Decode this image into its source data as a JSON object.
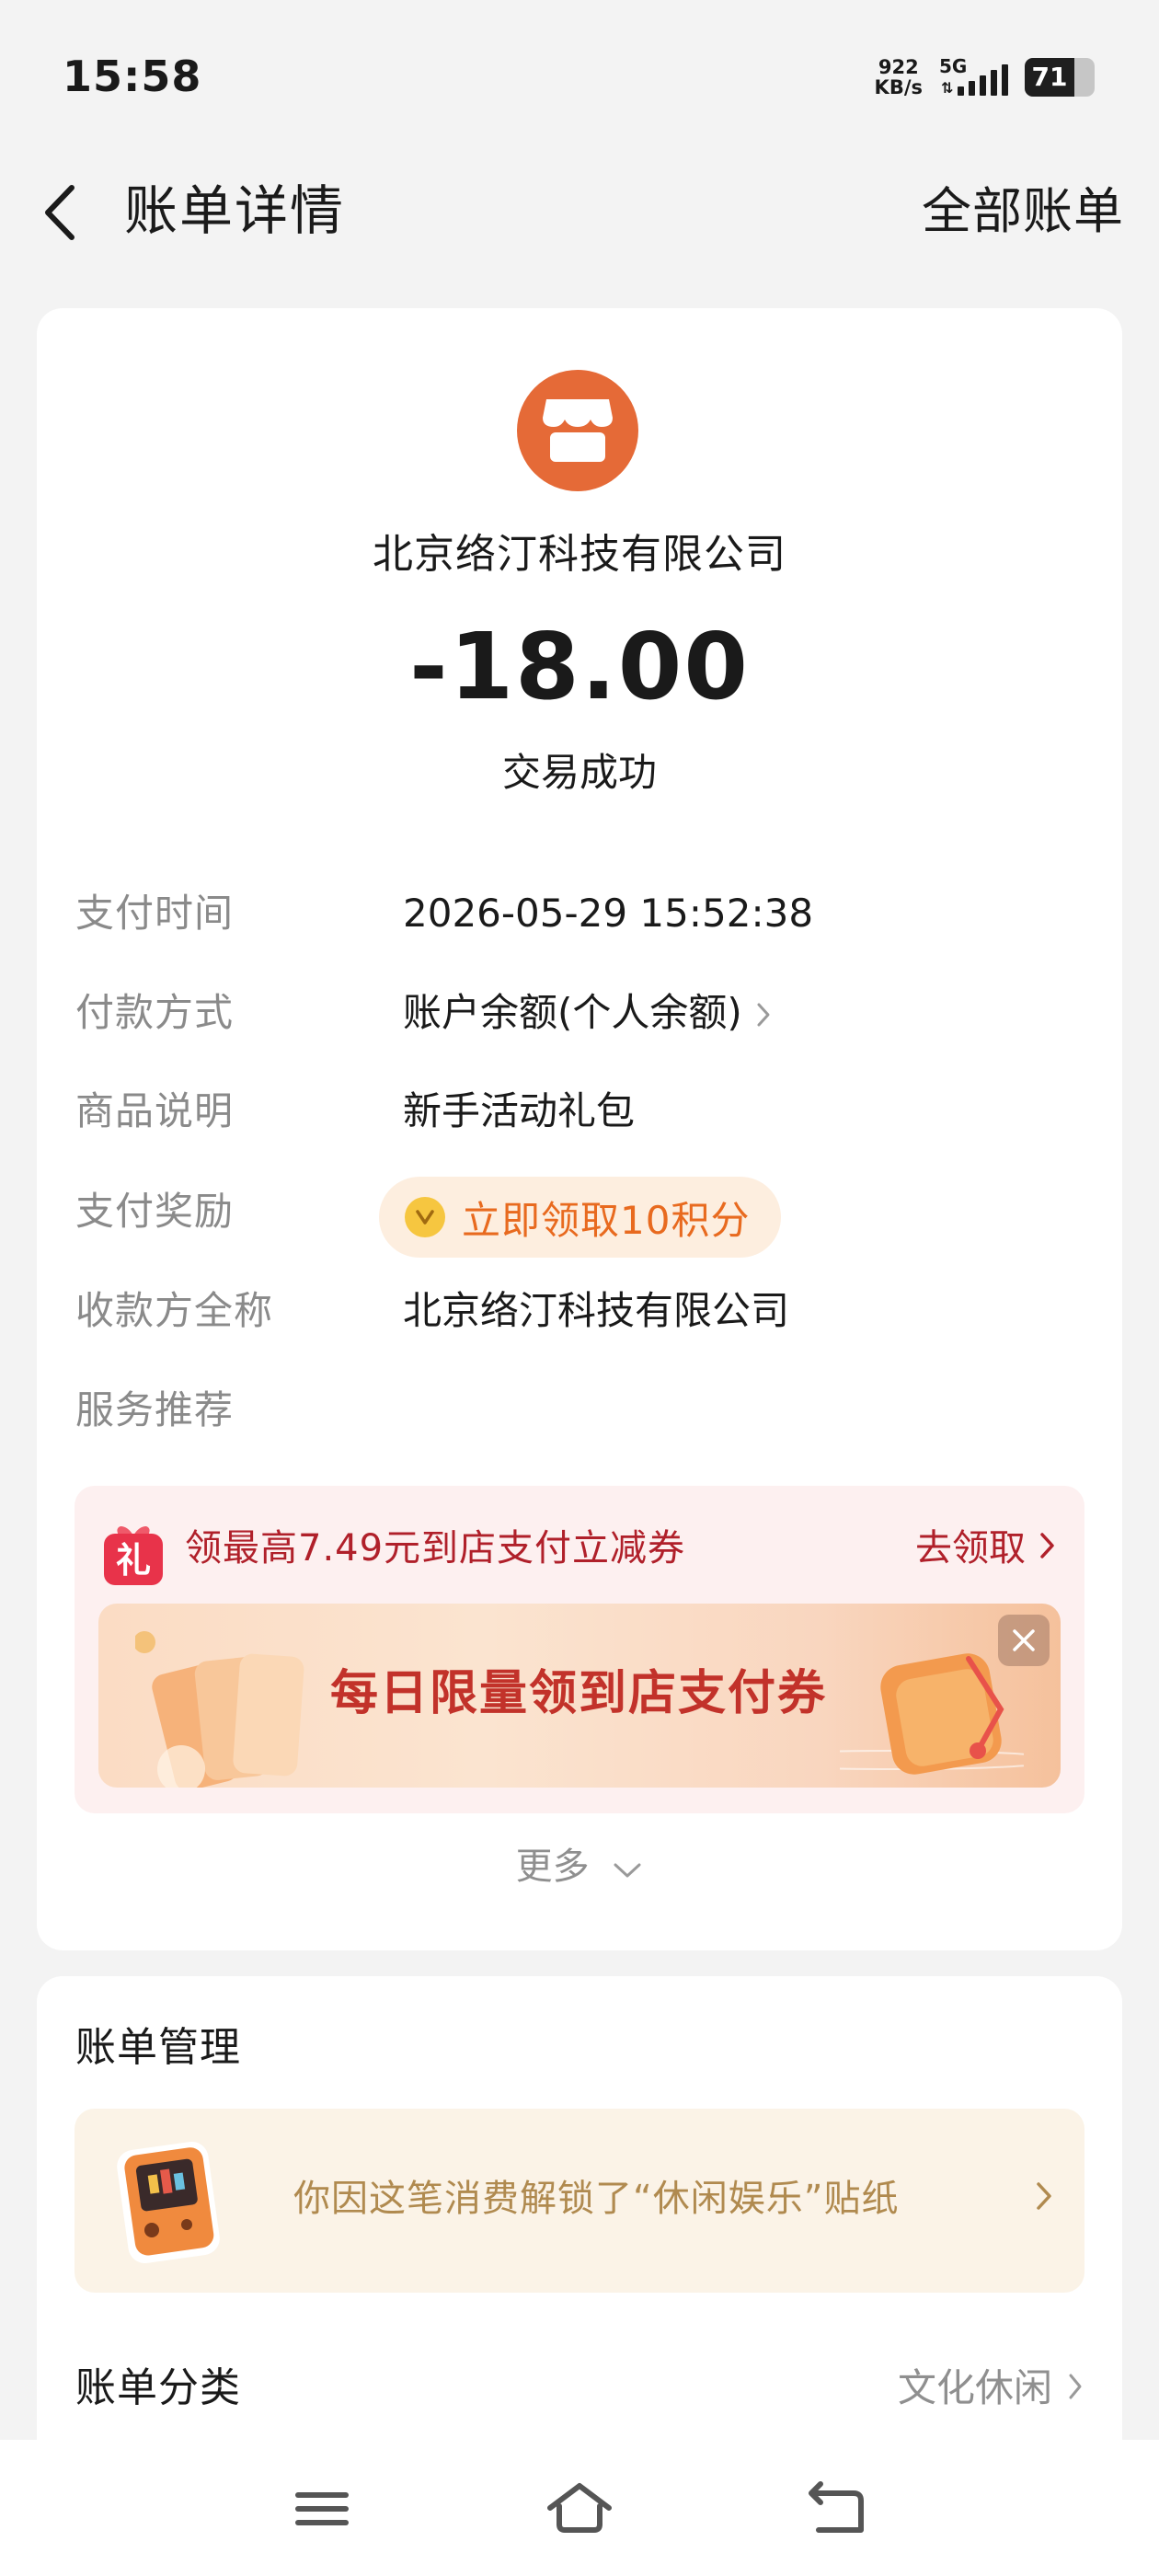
{
  "status_bar": {
    "time": "15:58",
    "net_speed_value": "922",
    "net_speed_unit": "KB/s",
    "network": "5G",
    "battery": "71"
  },
  "header": {
    "back_icon": "chevron-left-icon",
    "title": "账单详情",
    "all_bills": "全部账单"
  },
  "transaction": {
    "merchant_icon": "store-icon",
    "merchant_color": "#e56a37",
    "merchant": "北京络汀科技有限公司",
    "amount": "-18.00",
    "status": "交易成功"
  },
  "details": {
    "pay_time_label": "支付时间",
    "pay_time_value": "2026-05-29 15:52:38",
    "method_label": "付款方式",
    "method_value": "账户余额(个人余额)",
    "product_label": "商品说明",
    "product_value": "新手活动礼包",
    "reward_label": "支付奖励",
    "reward_value": "立即领取10积分",
    "payee_label": "收款方全称",
    "payee_value": "北京络汀科技有限公司",
    "service_label": "服务推荐"
  },
  "promo": {
    "text": "领最高7.49元到店支付立减券",
    "claim": "去领取",
    "banner_text": "每日限量领到店支付券",
    "gift_icon": "gift-icon",
    "gift_glyph": "礼"
  },
  "more": "更多",
  "management": {
    "title": "账单管理",
    "sticker_text": "你因这笔消费解锁了“休闲娱乐”贴纸",
    "category_label": "账单分类",
    "category_value": "文化休闲"
  },
  "nav": {
    "menu_icon": "menu-icon",
    "home_icon": "home-icon",
    "back_icon": "back-icon"
  }
}
